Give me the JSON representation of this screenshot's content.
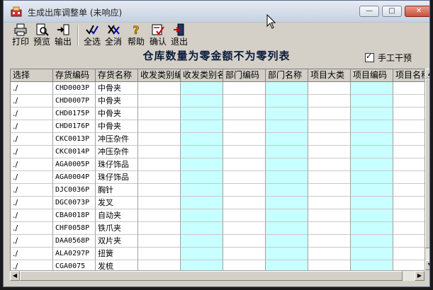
{
  "window": {
    "title": "生成出库调整单 (未响应)",
    "controls": {
      "minimize": "—",
      "maximize": "□",
      "close": "✕"
    }
  },
  "toolbar": {
    "buttons": [
      {
        "label": "打印",
        "icon": "printer-icon"
      },
      {
        "label": "预览",
        "icon": "preview-icon"
      },
      {
        "label": "输出",
        "icon": "export-icon"
      },
      {
        "label": "全选",
        "icon": "select-all-icon"
      },
      {
        "label": "全消",
        "icon": "deselect-all-icon"
      },
      {
        "label": "帮助",
        "icon": "help-icon"
      },
      {
        "label": "确认",
        "icon": "confirm-icon"
      },
      {
        "label": "退出",
        "icon": "exit-icon"
      }
    ]
  },
  "report": {
    "heading": "仓库数量为零金额不为零列表"
  },
  "manual": {
    "label": "手工干预",
    "checked": true
  },
  "grid": {
    "columns": [
      "选择",
      "存货编码",
      "存货名称",
      "收发类别编码",
      "收发类别名称",
      "部门编码",
      "部门名称",
      "项目大类",
      "项目编码",
      "项目名称"
    ],
    "rows": [
      {
        "select": "./",
        "code": "CHD0003P",
        "name": "中骨夹"
      },
      {
        "select": "./",
        "code": "CHD0007P",
        "name": "中骨夹"
      },
      {
        "select": "./",
        "code": "CHD0175P",
        "name": "中骨夹"
      },
      {
        "select": "./",
        "code": "CHD0176P",
        "name": "中骨夹"
      },
      {
        "select": "./",
        "code": "CKC0013P",
        "name": "冲压杂件"
      },
      {
        "select": "./",
        "code": "CKC0014P",
        "name": "冲压杂件"
      },
      {
        "select": "./",
        "code": "AGA0005P",
        "name": "珠仔饰品"
      },
      {
        "select": "./",
        "code": "AGA0004P",
        "name": "珠仔饰品"
      },
      {
        "select": "./",
        "code": "DJC0036P",
        "name": "胸针"
      },
      {
        "select": "./",
        "code": "DGC0073P",
        "name": "发叉"
      },
      {
        "select": "./",
        "code": "CBA0018P",
        "name": "自动夹"
      },
      {
        "select": "./",
        "code": "CHF0058P",
        "name": "铁爪夹"
      },
      {
        "select": "./",
        "code": "DAA0568P",
        "name": "双片夹"
      },
      {
        "select": "./",
        "code": "ALA0297P",
        "name": "扭簧"
      },
      {
        "select": "./",
        "code": "CGA0075",
        "name": "发梳"
      }
    ]
  },
  "colors": {
    "cyan_column": "#c8ffff",
    "window_face": "#d4d0c8"
  }
}
